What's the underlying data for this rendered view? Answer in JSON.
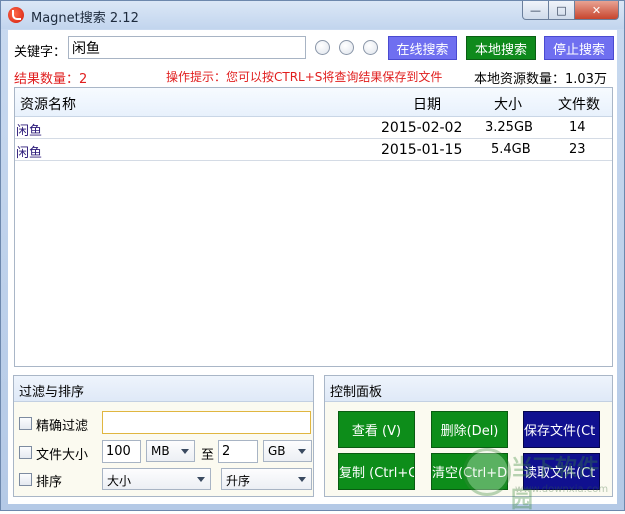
{
  "window": {
    "title": "Magnet搜索 2.12",
    "controls": {
      "minimize": "—",
      "maximize": "□",
      "close": "✕"
    }
  },
  "search": {
    "keyword_label": "关键字：",
    "keyword_value": "闲鱼",
    "online_search": "在线搜索",
    "local_search": "本地搜索",
    "stop_search": "停止搜索"
  },
  "status": {
    "result_count": "结果数量：2",
    "hint": "操作提示：您可以按CTRL+S将查询结果保存到文件",
    "local_count": "本地资源数量：1.03万"
  },
  "table": {
    "columns": {
      "name": "资源名称",
      "date": "日期",
      "size": "大小",
      "files": "文件数"
    },
    "rows": [
      {
        "name": "闲鱼",
        "date": "2015-02-02",
        "size": "3.25GB",
        "files": "14"
      },
      {
        "name": "闲鱼",
        "date": "2015-01-15",
        "size": "5.4GB",
        "files": "23"
      }
    ]
  },
  "filter": {
    "title": "过滤与排序",
    "exact_label": "精确过滤",
    "exact_value": "",
    "size_label": "文件大小",
    "size_from": "100",
    "size_from_unit": "MB",
    "to_label": "至",
    "size_to": "2",
    "size_to_unit": "GB",
    "sort_label": "排序",
    "sort_field": "大小",
    "sort_order": "升序"
  },
  "control": {
    "title": "控制面板",
    "view": "查看 (V)",
    "delete": "删除(Del)",
    "save_file": "保存文件(Ct",
    "copy": "复制 (Ctrl+C",
    "clear": "清空(Ctrl+D",
    "read_file": "读取文件(Ct"
  },
  "watermark": {
    "text": "当下软件园",
    "url": "www.downxia.com"
  },
  "colors": {
    "purple_button": "#6f6ff0",
    "green_button": "#0f8a1c",
    "navy_button": "#10108f",
    "red_text": "#e01e1e"
  }
}
